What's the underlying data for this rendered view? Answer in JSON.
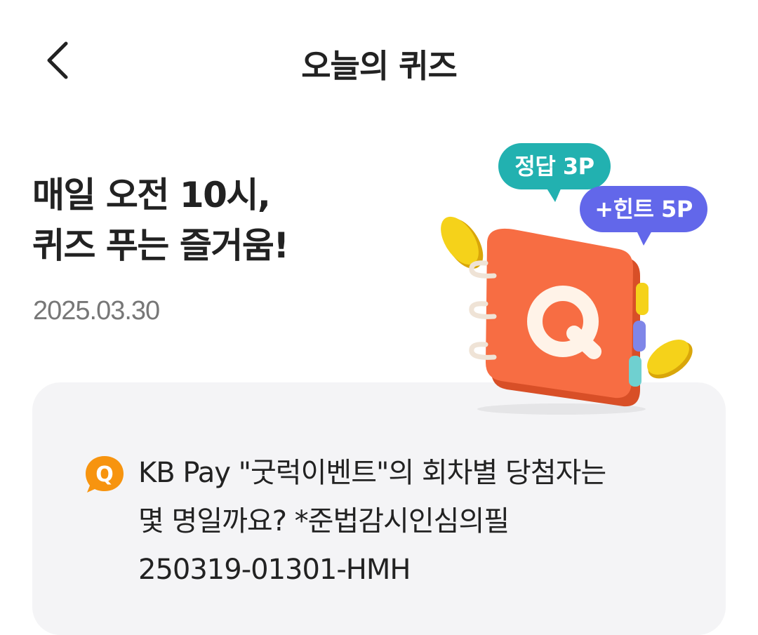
{
  "header": {
    "title": "오늘의 퀴즈",
    "back_icon": "chevron-left-icon"
  },
  "hero": {
    "headline_line1": "매일 오전 10시,",
    "headline_line2": "퀴즈 푸는 즐거움!",
    "date": "2025.03.30",
    "bubble_answer": "정답 3P",
    "bubble_hint": "+힌트 5P",
    "book_letter": "Q",
    "colors": {
      "answer_bubble": "#22b1b0",
      "hint_bubble": "#6267ea",
      "book": "#f76d43",
      "coin": "#f5d21a"
    }
  },
  "question": {
    "badge": "Q",
    "line1": "KB Pay \"굿럭이벤트\"의 회차별 당첨자는",
    "line2": "몇 명일까요? *준법감시인심의필",
    "line3": "250319-01301-HMH",
    "badge_color": "#f7940f"
  }
}
